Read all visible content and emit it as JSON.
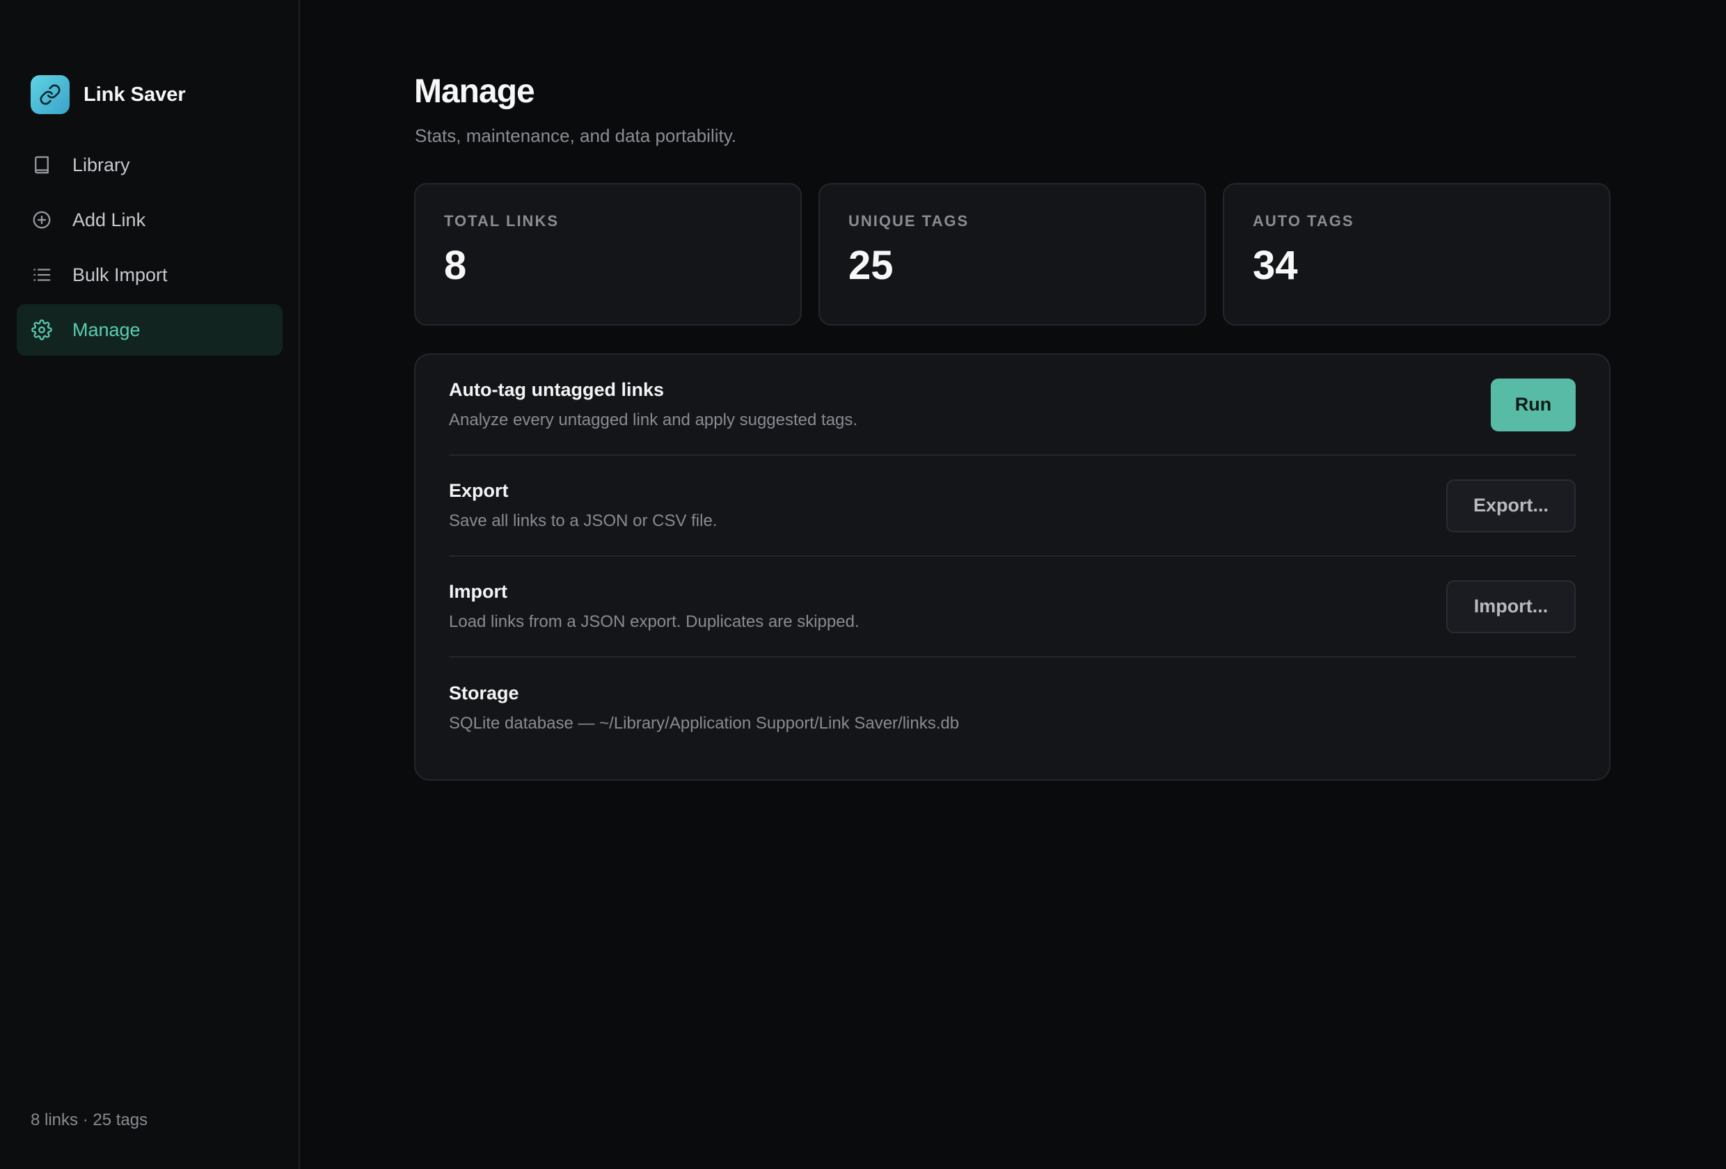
{
  "app": {
    "name": "Link Saver",
    "logo_icon": "link-icon",
    "accent_color": "#57bba5"
  },
  "sidebar": {
    "items": [
      {
        "label": "Library",
        "icon": "book-icon",
        "active": false
      },
      {
        "label": "Add Link",
        "icon": "plus-circle-icon",
        "active": false
      },
      {
        "label": "Bulk Import",
        "icon": "list-icon",
        "active": false
      },
      {
        "label": "Manage",
        "icon": "gear-icon",
        "active": true
      }
    ],
    "footer": "8 links · 25 tags"
  },
  "page": {
    "title": "Manage",
    "subtitle": "Stats, maintenance, and data portability."
  },
  "stats": [
    {
      "label": "TOTAL LINKS",
      "value": "8"
    },
    {
      "label": "UNIQUE TAGS",
      "value": "25"
    },
    {
      "label": "AUTO TAGS",
      "value": "34"
    }
  ],
  "actions": {
    "autotag": {
      "title": "Auto-tag untagged links",
      "description": "Analyze every untagged link and apply suggested tags.",
      "button": "Run"
    },
    "export": {
      "title": "Export",
      "description": "Save all links to a JSON or CSV file.",
      "button": "Export..."
    },
    "import": {
      "title": "Import",
      "description": "Load links from a JSON export. Duplicates are skipped.",
      "button": "Import..."
    },
    "storage": {
      "title": "Storage",
      "description": "SQLite database — ~/Library/Application Support/Link Saver/links.db"
    }
  }
}
